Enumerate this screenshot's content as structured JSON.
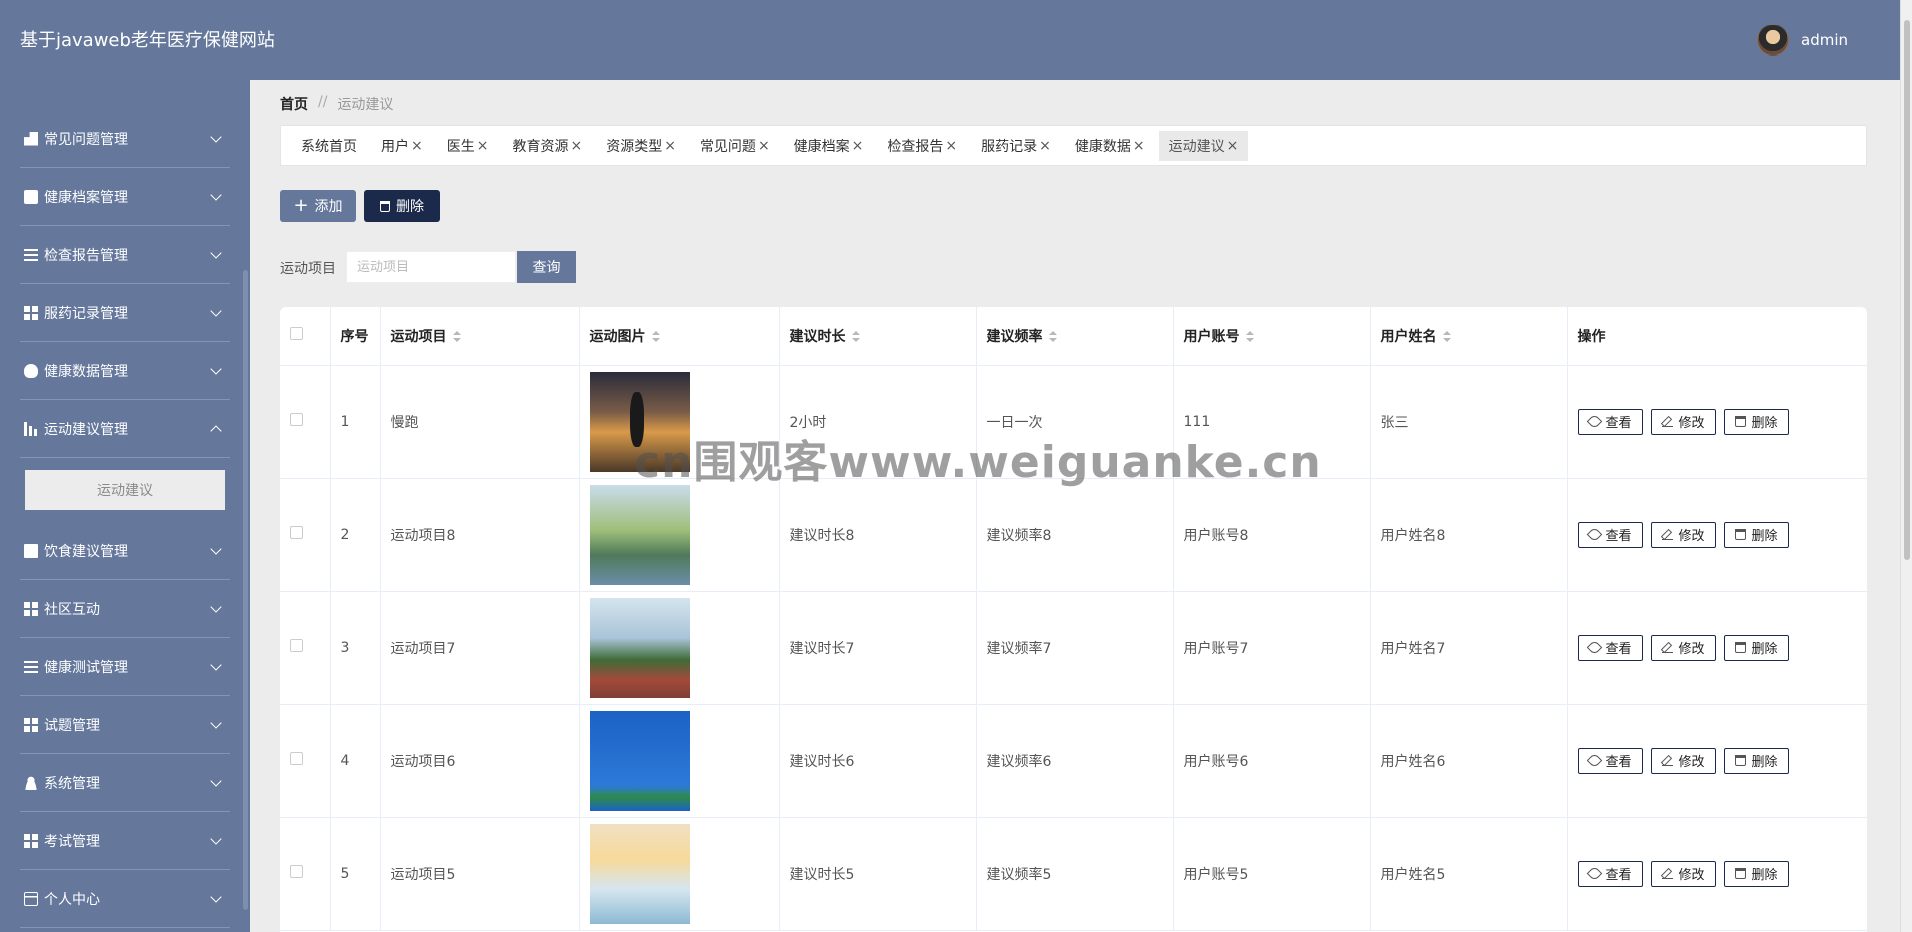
{
  "app": {
    "title": "基于javaweb老年医疗保健网站",
    "username": "admin"
  },
  "sidebar": {
    "items": [
      {
        "label": "常见问题管理",
        "icon": "hand-icon",
        "expanded": false
      },
      {
        "label": "健康档案管理",
        "icon": "clipboard-icon",
        "expanded": false
      },
      {
        "label": "检查报告管理",
        "icon": "list-icon",
        "expanded": false
      },
      {
        "label": "服药记录管理",
        "icon": "grid-icon",
        "expanded": false
      },
      {
        "label": "健康数据管理",
        "icon": "bulb-icon",
        "expanded": false
      },
      {
        "label": "运动建议管理",
        "icon": "chart-icon",
        "expanded": true
      },
      {
        "label": "饮食建议管理",
        "icon": "ticket-icon",
        "expanded": false
      },
      {
        "label": "社区互动",
        "icon": "grid-icon",
        "expanded": false
      },
      {
        "label": "健康测试管理",
        "icon": "list-icon",
        "expanded": false
      },
      {
        "label": "试题管理",
        "icon": "grid-icon",
        "expanded": false
      },
      {
        "label": "系统管理",
        "icon": "user-icon",
        "expanded": false
      },
      {
        "label": "考试管理",
        "icon": "grid-icon",
        "expanded": false
      },
      {
        "label": "个人中心",
        "icon": "card-icon",
        "expanded": false
      }
    ],
    "submenu": {
      "label": "运动建议"
    }
  },
  "breadcrumb": {
    "home": "首页",
    "sep": "//",
    "current": "运动建议"
  },
  "tabs": [
    {
      "label": "系统首页",
      "closable": false
    },
    {
      "label": "用户",
      "closable": true
    },
    {
      "label": "医生",
      "closable": true
    },
    {
      "label": "教育资源",
      "closable": true
    },
    {
      "label": "资源类型",
      "closable": true
    },
    {
      "label": "常见问题",
      "closable": true
    },
    {
      "label": "健康档案",
      "closable": true
    },
    {
      "label": "检查报告",
      "closable": true
    },
    {
      "label": "服药记录",
      "closable": true
    },
    {
      "label": "健康数据",
      "closable": true
    },
    {
      "label": "运动建议",
      "closable": true,
      "active": true
    }
  ],
  "toolbar": {
    "add_label": "添加",
    "delete_label": "删除"
  },
  "search": {
    "label": "运动项目",
    "placeholder": "运动项目",
    "value": "",
    "button": "查询"
  },
  "table": {
    "headers": {
      "index": "序号",
      "item": "运动项目",
      "image": "运动图片",
      "duration": "建议时长",
      "frequency": "建议频率",
      "account": "用户账号",
      "name": "用户姓名",
      "ops": "操作"
    },
    "rows": [
      {
        "index": "1",
        "item": "慢跑",
        "duration": "2小时",
        "frequency": "一日一次",
        "account": "111",
        "name": "张三"
      },
      {
        "index": "2",
        "item": "运动项目8",
        "duration": "建议时长8",
        "frequency": "建议频率8",
        "account": "用户账号8",
        "name": "用户姓名8"
      },
      {
        "index": "3",
        "item": "运动项目7",
        "duration": "建议时长7",
        "frequency": "建议频率7",
        "account": "用户账号7",
        "name": "用户姓名7"
      },
      {
        "index": "4",
        "item": "运动项目6",
        "duration": "建议时长6",
        "frequency": "建议频率6",
        "account": "用户账号6",
        "name": "用户姓名6"
      },
      {
        "index": "5",
        "item": "运动项目5",
        "duration": "建议时长5",
        "frequency": "建议频率5",
        "account": "用户账号5",
        "name": "用户姓名5"
      }
    ],
    "ops": {
      "view": "查看",
      "edit": "修改",
      "delete": "删除"
    }
  },
  "watermark": "cn围观客www.weiguanke.cn",
  "colors": {
    "primary": "#65789c",
    "dark": "#1b2a4a",
    "background": "#ececec"
  }
}
